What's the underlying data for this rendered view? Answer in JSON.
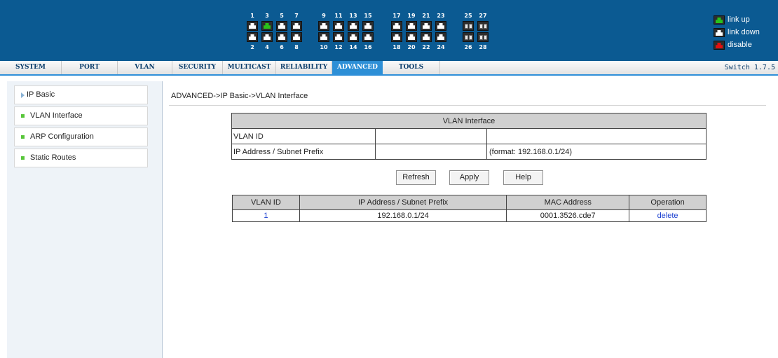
{
  "ports": {
    "top_numbers": [
      "1",
      "3",
      "5",
      "7",
      "9",
      "11",
      "13",
      "15",
      "17",
      "19",
      "21",
      "23",
      "25",
      "27"
    ],
    "bottom_numbers": [
      "2",
      "4",
      "6",
      "8",
      "10",
      "12",
      "14",
      "16",
      "18",
      "20",
      "22",
      "24",
      "26",
      "28"
    ]
  },
  "legend": {
    "link_up": "link up",
    "link_down": "link down",
    "disable": "disable"
  },
  "colors": {
    "header_bg": "#0b5a92",
    "menu_active": "#2d8fd6",
    "link_up": "#29c21c",
    "disable": "#e01010",
    "link": "#1a3fd0"
  },
  "menu": {
    "items": [
      "SYSTEM",
      "PORT",
      "VLAN",
      "SECURITY",
      "MULTICAST",
      "RELIABILITY",
      "ADVANCED",
      "TOOLS"
    ],
    "active": "ADVANCED",
    "version": "Switch 1.7.5"
  },
  "sidebar": {
    "items": [
      {
        "label": "IP Basic",
        "icon": "triangle-right-icon"
      },
      {
        "label": "VLAN Interface",
        "icon": "green-square-icon"
      },
      {
        "label": "ARP Configuration",
        "icon": "green-square-icon"
      },
      {
        "label": "Static Routes",
        "icon": "green-square-icon"
      }
    ]
  },
  "breadcrumb": "ADVANCED->IP Basic->VLAN Interface",
  "form": {
    "title": "VLAN Interface",
    "vlan_id_label": "VLAN ID",
    "vlan_id_value": "",
    "ip_label": "IP Address / Subnet Prefix",
    "ip_value": "",
    "ip_hint": "(format: 192.168.0.1/24)"
  },
  "buttons": {
    "refresh": "Refresh",
    "apply": "Apply",
    "help": "Help"
  },
  "table": {
    "headers": [
      "VLAN ID",
      "IP Address / Subnet Prefix",
      "MAC Address",
      "Operation"
    ],
    "rows": [
      {
        "vlan_id": "1",
        "ip": "192.168.0.1/24",
        "mac": "0001.3526.cde7",
        "operation": "delete"
      }
    ]
  }
}
